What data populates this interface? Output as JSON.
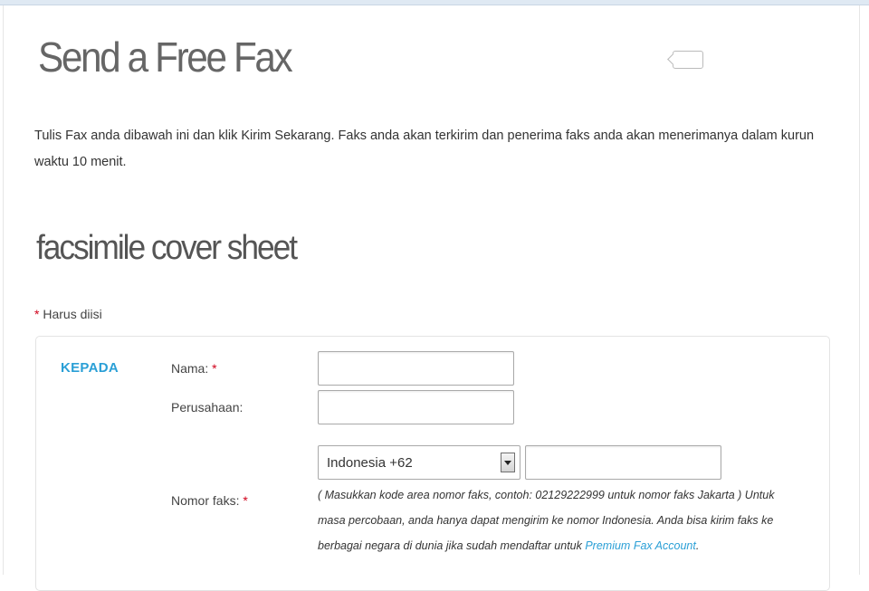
{
  "page": {
    "title": "Send a Free Fax",
    "intro": "Tulis Fax anda dibawah ini dan klik Kirim Sekarang. Faks anda akan terkirim dan penerima faks anda akan menerimanya dalam kurun waktu 10 menit."
  },
  "cover": {
    "title": "facsimile cover sheet",
    "required_asterisk": "*",
    "required_note": " Harus diisi"
  },
  "form": {
    "section_label": "KEPADA",
    "name_label": "Nama: ",
    "name_value": "",
    "company_label": "Perusahaan:",
    "company_value": "",
    "fax_label": "Nomor faks: ",
    "country_selected": "Indonesia +62",
    "fax_number_value": "",
    "asterisk": "*",
    "help_text": "( Masukkan kode area nomor faks, contoh: 02129222999 untuk nomor faks Jakarta ) Untuk masa percobaan, anda hanya dapat mengirim ke nomor Indonesia. Anda bisa kirim faks ke berbagai negara di dunia jika sudah mendaftar untuk ",
    "help_link": "Premium Fax Account",
    "help_end": "."
  },
  "colors": {
    "accent": "#2a9fd6",
    "required": "#d0021b"
  }
}
